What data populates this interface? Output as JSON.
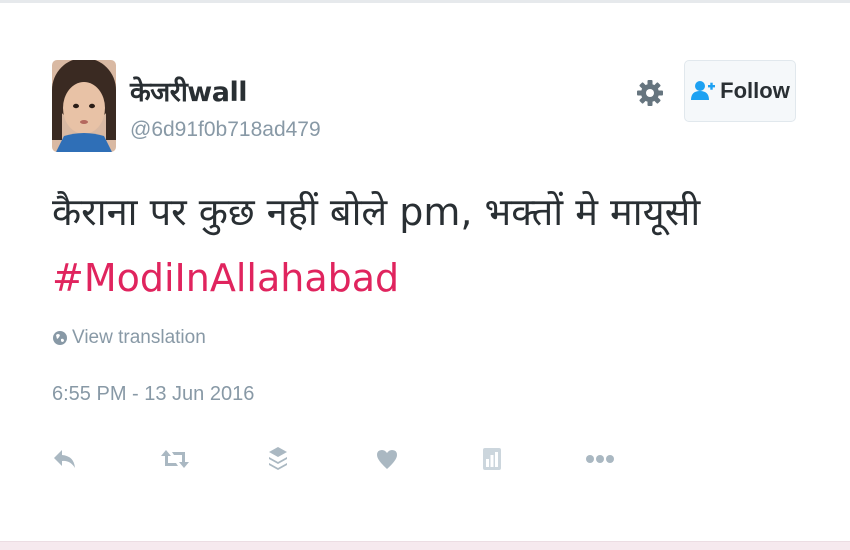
{
  "user": {
    "display_name": "केजरीwall",
    "handle": "@6d91f0b718ad479"
  },
  "header": {
    "follow_label": "Follow",
    "settings_icon": "gear-icon",
    "follow_icon": "follow-person-plus-icon"
  },
  "tweet": {
    "text": "कैराना पर कुछ नहीं बोले pm, भक्तों मे मायूसी",
    "hashtag": "#ModiInAllahabad",
    "translation_label": "View translation",
    "timestamp": "6:55 PM - 13 Jun 2016"
  },
  "actions": [
    {
      "name": "reply-icon"
    },
    {
      "name": "retweet-icon"
    },
    {
      "name": "stack-icon"
    },
    {
      "name": "like-heart-icon"
    },
    {
      "name": "analytics-icon"
    },
    {
      "name": "more-dots-icon"
    }
  ],
  "colors": {
    "text": "#292f33",
    "muted": "#8899a6",
    "hashtag": "#e0245e",
    "icon": "#aab8c2",
    "follow_icon": "#1da1f2"
  }
}
